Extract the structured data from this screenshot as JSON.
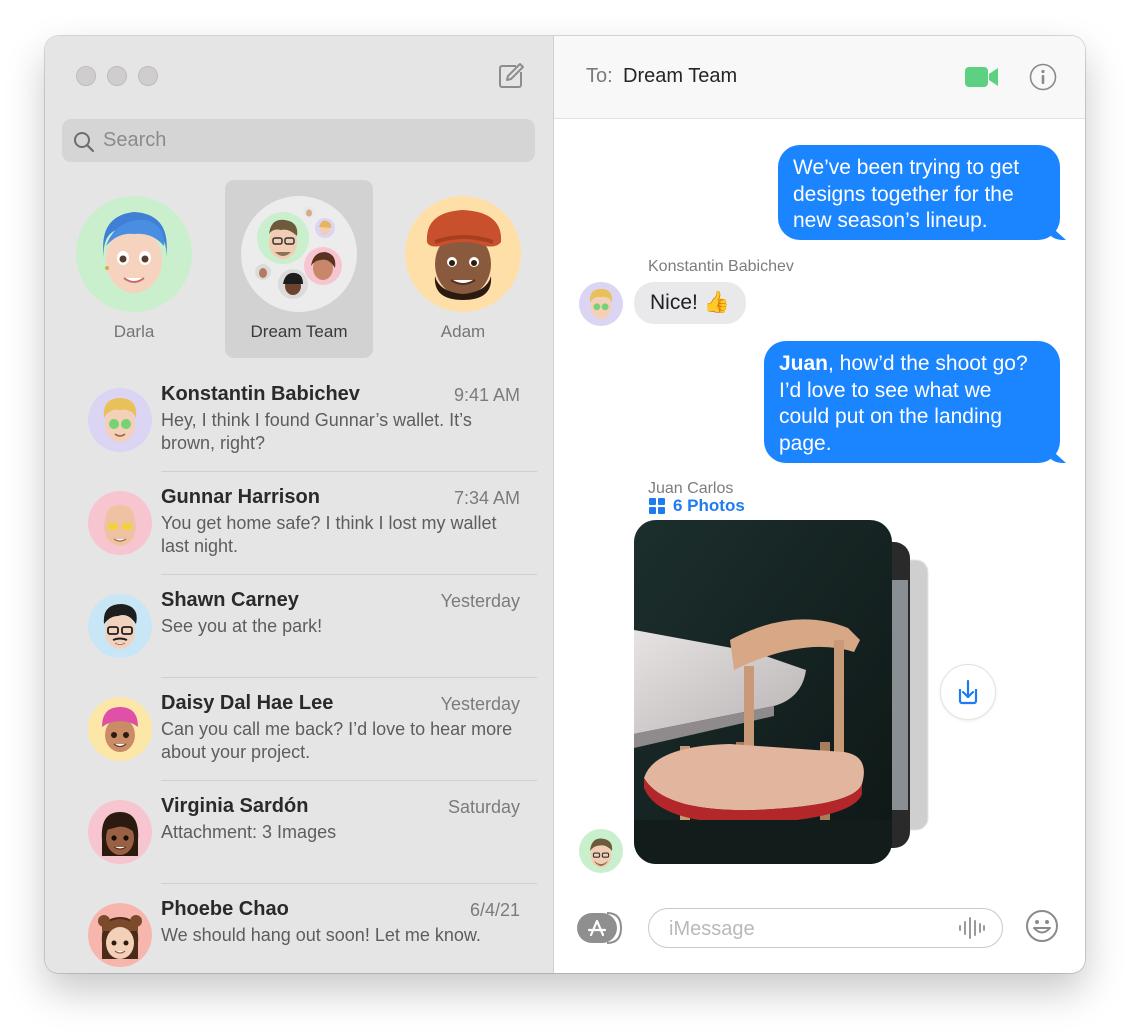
{
  "sidebar": {
    "search": {
      "placeholder": "Search"
    },
    "pinned": [
      {
        "name": "Darla",
        "bg": "#c9efcc"
      },
      {
        "name": "Dream Team",
        "bg": "#ececec",
        "selected": true
      },
      {
        "name": "Adam",
        "bg": "#ffdfa8"
      }
    ],
    "conversations": [
      {
        "name": "Konstantin Babichev",
        "time": "9:41 AM",
        "preview": "Hey, I think I found Gunnar’s wallet. It’s brown, right?",
        "bg": "#dcd4f3"
      },
      {
        "name": "Gunnar Harrison",
        "time": "7:34 AM",
        "preview": "You get home safe? I think I lost my wallet last night.",
        "bg": "#f7c5cf"
      },
      {
        "name": "Shawn Carney",
        "time": "Yesterday",
        "preview": "See you at the park!",
        "bg": "#c8e6f5"
      },
      {
        "name": "Daisy Dal Hae Lee",
        "time": "Yesterday",
        "preview": "Can you call me back? I’d love to hear more about your project.",
        "bg": "#fde7a8"
      },
      {
        "name": "Virginia Sardón",
        "time": "Saturday",
        "preview": "Attachment: 3 Images",
        "bg": "#f7c5cf"
      },
      {
        "name": "Phoebe Chao",
        "time": "6/4/21",
        "preview": "We should hang out soon! Let me know.",
        "bg": "#f7b6ad"
      }
    ]
  },
  "conversation": {
    "to_label": "To:",
    "to_name": "Dream Team",
    "messages": {
      "m1": "We’ve been trying to get designs together for the new season’s lineup.",
      "m2_sender": "Konstantin Babichev",
      "m2": "Nice! 👍",
      "m3_bold": "Juan",
      "m3_rest": ", how’d the shoot go? I’d love to see what we could put on the landing page.",
      "m4_sender": "Juan Carlos",
      "m4_photos": "6 Photos"
    },
    "input": {
      "placeholder": "iMessage"
    }
  },
  "colors": {
    "accent": "#1b84ff",
    "facetime_green": "#5ed082",
    "sidebar_bg": "#e6e5e5"
  },
  "icons": [
    "search-icon",
    "compose-icon",
    "facetime-icon",
    "info-icon",
    "app-store-icon",
    "audio-waveform-icon",
    "emoji-icon",
    "save-download-icon",
    "grid-icon"
  ]
}
